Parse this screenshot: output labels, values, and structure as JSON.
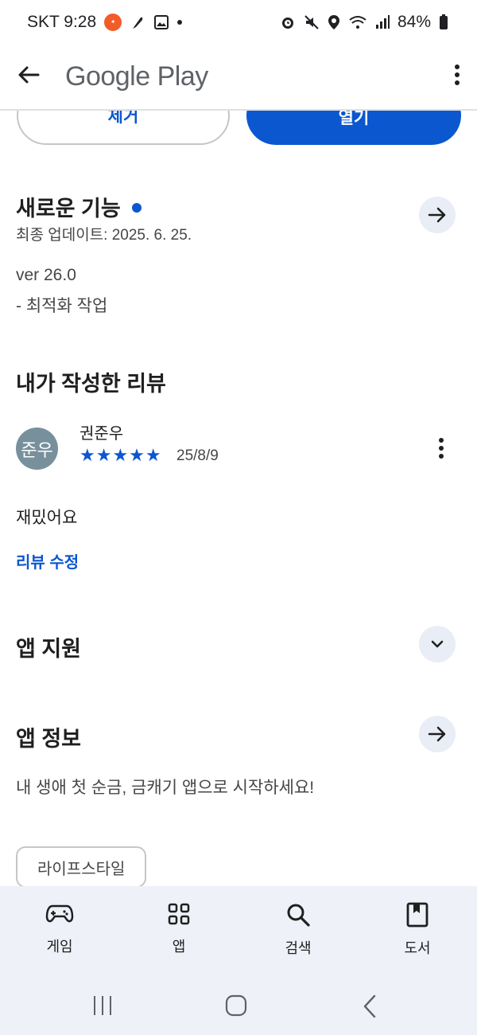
{
  "status_bar": {
    "carrier_time": "SKT 9:28",
    "battery": "84%"
  },
  "app_bar": {
    "title": "Google Play"
  },
  "actions": {
    "remove_label": "제거",
    "open_label": "열기"
  },
  "whats_new": {
    "title": "새로운 기능",
    "updated": "최종 업데이트: 2025. 6. 25.",
    "version": "ver 26.0",
    "notes": "- 최적화 작업"
  },
  "my_review": {
    "title": "내가 작성한 리뷰",
    "avatar_text": "준우",
    "reviewer": "권준우",
    "stars": "★★★★★",
    "rating": 5,
    "date": "25/8/9",
    "text": "재밌어요",
    "edit_label": "리뷰 수정"
  },
  "app_support": {
    "title": "앱 지원"
  },
  "app_info": {
    "title": "앱 정보",
    "description": "내 생애 첫 순금, 금캐기 앱으로 시작하세요!",
    "tag": "라이프스타일"
  },
  "bottom_nav": [
    {
      "label": "게임",
      "icon": "gamepad-icon"
    },
    {
      "label": "앱",
      "icon": "apps-grid-icon"
    },
    {
      "label": "검색",
      "icon": "search-icon"
    },
    {
      "label": "도서",
      "icon": "book-icon"
    }
  ],
  "colors": {
    "accent": "#0b57d0",
    "nav_bg": "#eef2f8",
    "button_bg": "#e8edf6"
  }
}
